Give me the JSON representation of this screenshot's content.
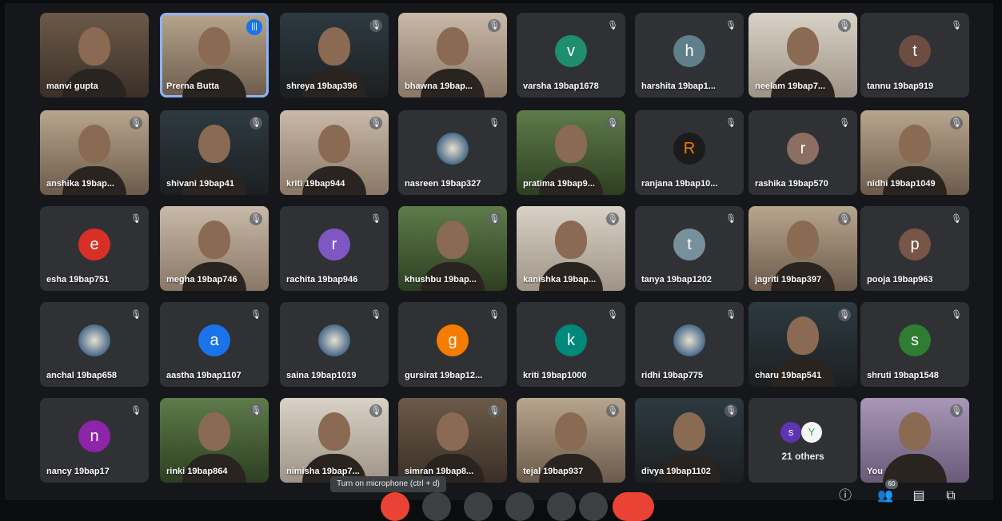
{
  "participants": [
    {
      "name": "manvi gupta",
      "kind": "video",
      "muted": false
    },
    {
      "name": "Prerna Butta",
      "kind": "video",
      "muted": false,
      "speaking": true
    },
    {
      "name": "shreya 19bap396",
      "kind": "video",
      "muted": true
    },
    {
      "name": "bhawna 19bap...",
      "kind": "video",
      "muted": true
    },
    {
      "name": "varsha 19bap1678",
      "kind": "avatar",
      "initial": "v",
      "color": "#1e8e6e",
      "muted": true
    },
    {
      "name": "harshita 19bap1...",
      "kind": "avatar",
      "initial": "h",
      "color": "#5f7f8a",
      "muted": true
    },
    {
      "name": "neelam 19bap7...",
      "kind": "video",
      "muted": true
    },
    {
      "name": "tannu 19bap919",
      "kind": "avatar",
      "initial": "t",
      "color": "#6d4c41",
      "muted": true
    },
    {
      "name": "anshika 19bap...",
      "kind": "video",
      "muted": true
    },
    {
      "name": "shivani 19bap41",
      "kind": "video",
      "muted": true
    },
    {
      "name": "kriti 19bap944",
      "kind": "video",
      "muted": true
    },
    {
      "name": "nasreen 19bap327",
      "kind": "image",
      "muted": true
    },
    {
      "name": "pratima 19bap9...",
      "kind": "video",
      "muted": true
    },
    {
      "name": "ranjana 19bap10...",
      "kind": "avatar",
      "initial": "R",
      "color": "#1b1b1b",
      "text_color": "#f57c00",
      "muted": true
    },
    {
      "name": "rashika 19bap570",
      "kind": "avatar",
      "initial": "r",
      "color": "#8d6e63",
      "muted": true
    },
    {
      "name": "nidhi 19bap1049",
      "kind": "video",
      "muted": true
    },
    {
      "name": "esha 19bap751",
      "kind": "avatar",
      "initial": "e",
      "color": "#d93025",
      "muted": true
    },
    {
      "name": "megha 19bap746",
      "kind": "video",
      "muted": true
    },
    {
      "name": "rachita 19bap946",
      "kind": "avatar",
      "initial": "r",
      "color": "#7e57c2",
      "muted": true
    },
    {
      "name": "khushbu 19bap...",
      "kind": "video",
      "muted": true
    },
    {
      "name": "kanishka 19bap...",
      "kind": "video",
      "muted": true
    },
    {
      "name": "tanya 19bap1202",
      "kind": "avatar",
      "initial": "t",
      "color": "#78909c",
      "muted": true
    },
    {
      "name": "jagriti 19bap397",
      "kind": "video",
      "muted": true
    },
    {
      "name": "pooja 19bap963",
      "kind": "avatar",
      "initial": "p",
      "color": "#795548",
      "muted": true
    },
    {
      "name": "anchal 19bap658",
      "kind": "image",
      "muted": true
    },
    {
      "name": "aastha 19bap1107",
      "kind": "avatar",
      "initial": "a",
      "color": "#1a73e8",
      "muted": true
    },
    {
      "name": "saina 19bap1019",
      "kind": "image",
      "muted": true
    },
    {
      "name": "gursirat 19bap12...",
      "kind": "avatar",
      "initial": "g",
      "color": "#f57c00",
      "muted": true
    },
    {
      "name": "kriti 19bap1000",
      "kind": "avatar",
      "initial": "k",
      "color": "#00897b",
      "muted": true
    },
    {
      "name": "ridhi 19bap775",
      "kind": "image",
      "muted": true
    },
    {
      "name": "charu 19bap541",
      "kind": "video",
      "muted": true
    },
    {
      "name": "shruti 19bap1548",
      "kind": "avatar",
      "initial": "s",
      "color": "#2e7d32",
      "muted": true
    },
    {
      "name": "nancy 19bap17",
      "kind": "avatar",
      "initial": "n",
      "color": "#8e24aa",
      "muted": true
    },
    {
      "name": "rinki 19bap864",
      "kind": "video",
      "muted": true
    },
    {
      "name": "nimisha 19bap7...",
      "kind": "video",
      "muted": true
    },
    {
      "name": "simran 19bap8...",
      "kind": "video",
      "muted": true
    },
    {
      "name": "tejal 19bap937",
      "kind": "video",
      "muted": true
    },
    {
      "name": "divya 19bap1102",
      "kind": "video",
      "muted": true
    },
    {
      "name": "21 others",
      "kind": "others",
      "muted": false
    },
    {
      "name": "You",
      "kind": "video",
      "muted": true
    }
  ],
  "others_avatars": [
    {
      "initial": "s",
      "color": "#5e35b1"
    },
    {
      "initial": "Y",
      "color": "#f5f5f5",
      "text_color": "#34a853"
    }
  ],
  "tooltip": "Turn on microphone (ctrl + d)",
  "participant_count": "60",
  "colors": {
    "tile": "#303134",
    "active_outline": "#8ab4f8",
    "leave": "#ea4335",
    "mic_off": "#ea4335"
  },
  "side_icons": [
    "info-icon",
    "people-icon",
    "chat-icon",
    "activities-icon"
  ]
}
